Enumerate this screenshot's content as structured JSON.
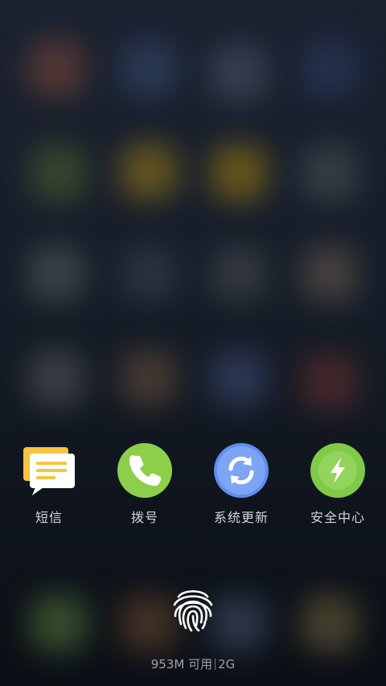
{
  "shortcuts": [
    {
      "label": "短信",
      "icon": "sms-icon"
    },
    {
      "label": "拨号",
      "icon": "phone-icon"
    },
    {
      "label": "系统更新",
      "icon": "sync-icon"
    },
    {
      "label": "安全中心",
      "icon": "lightning-icon"
    }
  ],
  "status": {
    "memory": "953M 可用",
    "network": "2G"
  },
  "colors": {
    "sms_yellow": "#f6c440",
    "phone_green": "#8dcf4b",
    "update_blue": "#5d8ef0",
    "security_green": "#7fca46"
  }
}
